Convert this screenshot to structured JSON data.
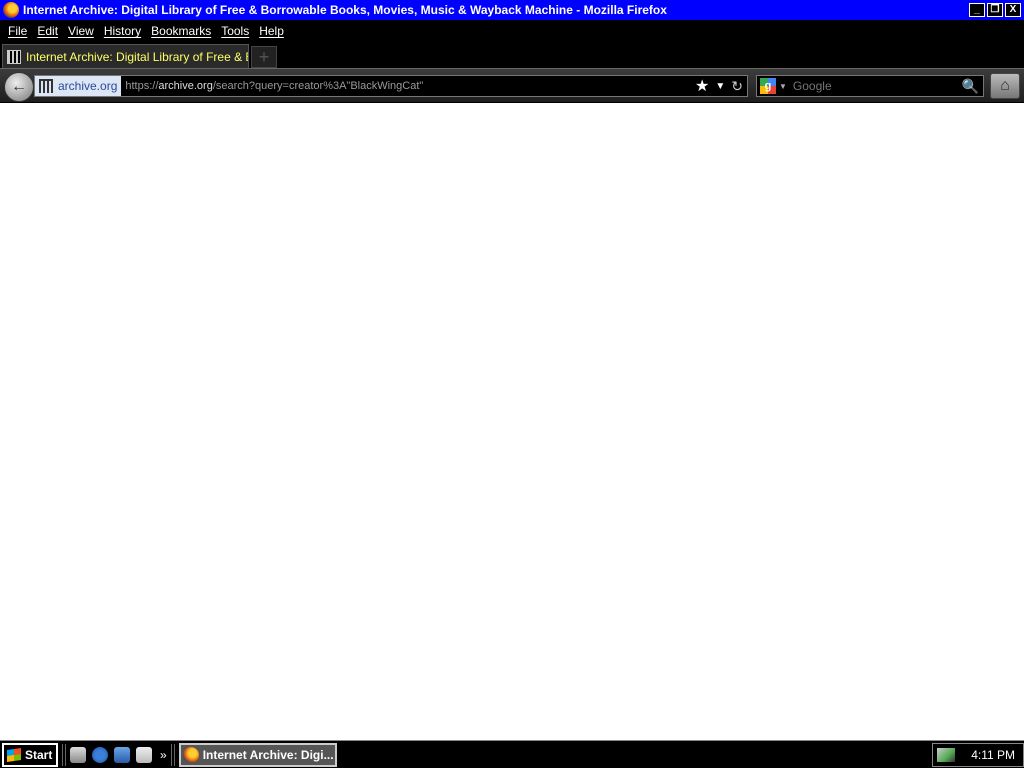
{
  "window": {
    "title": "Internet Archive: Digital Library of Free & Borrowable Books, Movies, Music & Wayback Machine - Mozilla Firefox",
    "minimize": "_",
    "restore": "❐",
    "close": "X"
  },
  "menu": {
    "items": [
      {
        "label": "File"
      },
      {
        "label": "Edit"
      },
      {
        "label": "View"
      },
      {
        "label": "History"
      },
      {
        "label": "Bookmarks"
      },
      {
        "label": "Tools"
      },
      {
        "label": "Help"
      }
    ]
  },
  "tabs": [
    {
      "title": "Internet Archive: Digital Library of Free & Borro...",
      "icon": "archive-icon",
      "active": true
    }
  ],
  "newtab": {
    "label": "+"
  },
  "nav": {
    "back": "←",
    "identity": "archive.org",
    "url_scheme": "https://",
    "url_host": "archive.org",
    "url_path": "/search?query=creator%3A\"BlackWingCat\"",
    "search_engine": "Google",
    "home": "⌂"
  },
  "taskbar": {
    "start": "Start",
    "task_label": "Internet Archive: Digi...",
    "more": "»",
    "clock": "4:11 PM"
  },
  "colors": {
    "titlebar": "#0000ff",
    "tab_title": "#ffff66",
    "search_text": "#4caf50"
  }
}
